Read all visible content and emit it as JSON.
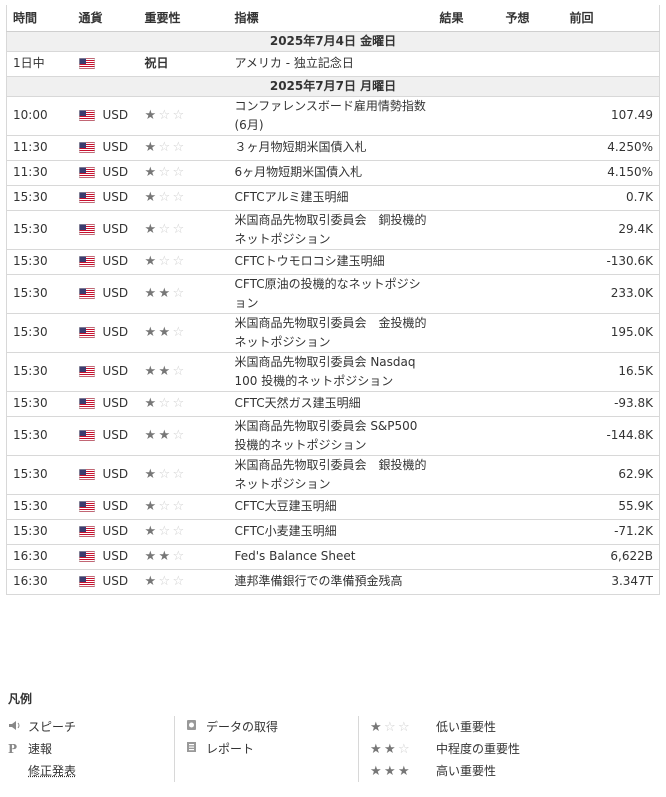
{
  "headers": {
    "time": "時間",
    "currency": "通貨",
    "importance": "重要性",
    "event": "指標",
    "actual": "結果",
    "forecast": "予想",
    "previous": "前回"
  },
  "colors": {
    "date_row_bg": "#f0f0f0",
    "star_on": "#777777",
    "star_off": "#cfcfcf"
  },
  "groups": [
    {
      "date": "2025年7月4日 金曜日",
      "rows": [
        {
          "time": "1日中",
          "currency": "",
          "holiday": "祝日",
          "event": "アメリカ - 独立記念日",
          "actual": "",
          "forecast": "",
          "previous": "",
          "importance": 0
        }
      ]
    },
    {
      "date": "2025年7月7日 月曜日",
      "rows": [
        {
          "time": "10:00",
          "currency": "USD",
          "event": "コンファレンスボード雇用情勢指数 (6月)",
          "actual": "",
          "forecast": "",
          "previous": "107.49",
          "importance": 1
        },
        {
          "time": "11:30",
          "currency": "USD",
          "event": "３ヶ月物短期米国債入札",
          "actual": "",
          "forecast": "",
          "previous": "4.250%",
          "importance": 1
        },
        {
          "time": "11:30",
          "currency": "USD",
          "event": "6ヶ月物短期米国債入札",
          "actual": "",
          "forecast": "",
          "previous": "4.150%",
          "importance": 1
        },
        {
          "time": "15:30",
          "currency": "USD",
          "event": "CFTCアルミ建玉明細",
          "actual": "",
          "forecast": "",
          "previous": "0.7K",
          "importance": 1
        },
        {
          "time": "15:30",
          "currency": "USD",
          "event": "米国商品先物取引委員会　銅投機的ネットポジション",
          "actual": "",
          "forecast": "",
          "previous": "29.4K",
          "importance": 1
        },
        {
          "time": "15:30",
          "currency": "USD",
          "event": "CFTCトウモロコシ建玉明細",
          "actual": "",
          "forecast": "",
          "previous": "-130.6K",
          "importance": 1
        },
        {
          "time": "15:30",
          "currency": "USD",
          "event": "CFTC原油の投機的なネットポジション",
          "actual": "",
          "forecast": "",
          "previous": "233.0K",
          "importance": 2
        },
        {
          "time": "15:30",
          "currency": "USD",
          "event": "米国商品先物取引委員会　金投機的ネットポジション",
          "actual": "",
          "forecast": "",
          "previous": "195.0K",
          "importance": 2
        },
        {
          "time": "15:30",
          "currency": "USD",
          "event": "米国商品先物取引委員会 Nasdaq 100 投機的ネットポジション",
          "actual": "",
          "forecast": "",
          "previous": "16.5K",
          "importance": 2
        },
        {
          "time": "15:30",
          "currency": "USD",
          "event": "CFTC天然ガス建玉明細",
          "actual": "",
          "forecast": "",
          "previous": "-93.8K",
          "importance": 1
        },
        {
          "time": "15:30",
          "currency": "USD",
          "event": "米国商品先物取引委員会 S&P500　投機的ネットポジション",
          "actual": "",
          "forecast": "",
          "previous": "-144.8K",
          "importance": 2
        },
        {
          "time": "15:30",
          "currency": "USD",
          "event": "米国商品先物取引委員会　銀投機的ネットポジション",
          "actual": "",
          "forecast": "",
          "previous": "62.9K",
          "importance": 1
        },
        {
          "time": "15:30",
          "currency": "USD",
          "event": "CFTC大豆建玉明細",
          "actual": "",
          "forecast": "",
          "previous": "55.9K",
          "importance": 1
        },
        {
          "time": "15:30",
          "currency": "USD",
          "event": "CFTC小麦建玉明細",
          "actual": "",
          "forecast": "",
          "previous": "-71.2K",
          "importance": 1
        },
        {
          "time": "16:30",
          "currency": "USD",
          "event": "Fed's Balance Sheet",
          "actual": "",
          "forecast": "",
          "previous": "6,622B",
          "importance": 2
        },
        {
          "time": "16:30",
          "currency": "USD",
          "event": "連邦準備銀行での準備預金残高",
          "actual": "",
          "forecast": "",
          "previous": "3.347T",
          "importance": 1
        }
      ]
    }
  ],
  "legend": {
    "title": "凡例",
    "col1": [
      {
        "icon": "speaker-icon",
        "label": "スピーチ"
      },
      {
        "icon": "preliminary-p-icon",
        "label": "速報"
      },
      {
        "icon": "",
        "label": "修正発表"
      }
    ],
    "col2": [
      {
        "icon": "data-retrieval-icon",
        "label": "データの取得"
      },
      {
        "icon": "report-icon",
        "label": "レポート"
      }
    ],
    "col3": [
      {
        "stars": 1,
        "label": "低い重要性"
      },
      {
        "stars": 2,
        "label": "中程度の重要性"
      },
      {
        "stars": 3,
        "label": "高い重要性"
      }
    ]
  }
}
